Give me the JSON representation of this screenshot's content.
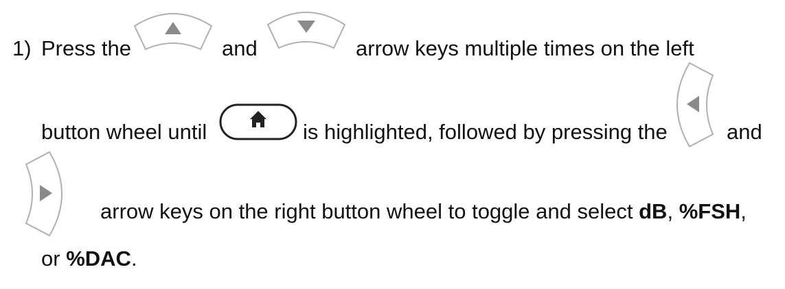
{
  "step": {
    "number": "1)",
    "text_1": "Press the",
    "text_2": "and",
    "text_3": "arrow keys multiple times on the left",
    "text_4": "button wheel until",
    "text_5": "is highlighted, followed by pressing the",
    "text_6": "and",
    "text_7": "arrow keys on the right button wheel to toggle and select",
    "option_db": "dB",
    "sep_1": ",",
    "option_fsh": "%FSH",
    "sep_2": ",",
    "text_8": "or",
    "option_dac": "%DAC",
    "end": "."
  },
  "icons": {
    "up": "up-arrow-key-icon",
    "down": "down-arrow-key-icon",
    "home": "home-key-icon",
    "left": "left-arrow-key-icon",
    "right": "right-arrow-key-icon"
  },
  "colors": {
    "text": "#111111",
    "key_outline": "#b0b0b0",
    "arrow": "#8a8a8a",
    "home_icon": "#222222"
  }
}
